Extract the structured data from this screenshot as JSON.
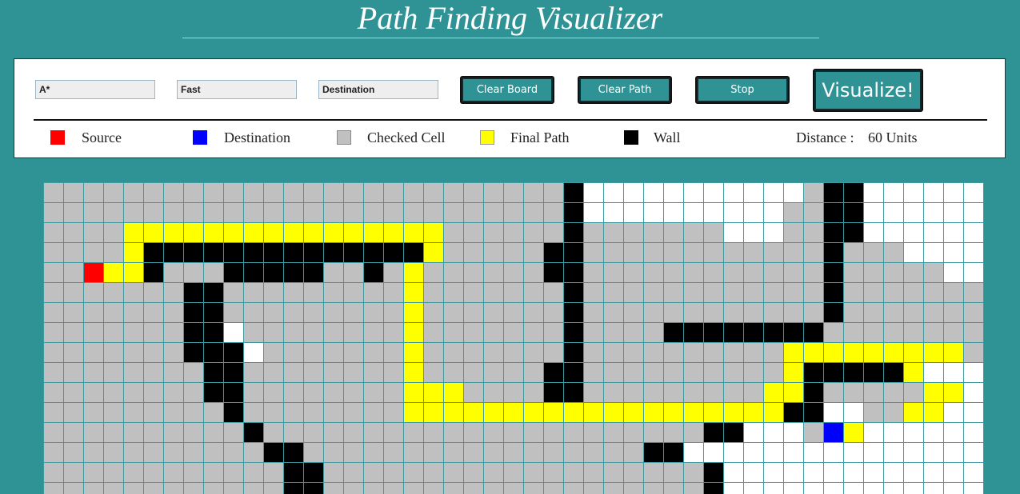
{
  "title": "Path Finding Visualizer",
  "controls": {
    "algorithm": "A*",
    "speed": "Fast",
    "mode": "Destination",
    "clear_board": "Clear Board",
    "clear_path": "Clear Path",
    "stop": "Stop",
    "visualize": "Visualize!"
  },
  "legend": [
    {
      "label": "Source",
      "color": "#ff0000"
    },
    {
      "label": "Destination",
      "color": "#0000ff"
    },
    {
      "label": "Checked Cell",
      "color": "#c0c0c0"
    },
    {
      "label": "Final Path",
      "color": "#ffff00"
    },
    {
      "label": "Wall",
      "color": "#000000"
    }
  ],
  "distance": {
    "label": "Distance :",
    "value": "60 Units"
  },
  "colors": {
    "background": "#2f9396",
    "checked": "#c0c0c0",
    "path": "#ffff00",
    "wall": "#000000",
    "empty": "#ffffff",
    "source": "#ff0000",
    "destination": "#0000ff"
  },
  "grid": {
    "legend": {
      ".": "checked",
      "o": "empty",
      "Y": "path",
      "W": "wall",
      "S": "source",
      "D": "destination"
    },
    "rows": [
      "..........................Wooooooooooo.WWooooooooooooooo",
      "..........................Woooooooooo..WWooooooooooooooo",
      "....YYYYYYYYYYYYYYYY......W.......ooo..WWooooooooooooooo",
      "....YWWWWWWWWWWWWWWY.....WW............W...ooooooooooooo",
      "..SYYW...WWWWW..W.Y......WW............W.....oooooooooooo",
      ".......WW.........Y.......W............W.......ooooooooo",
      ".......WW.........Y.......W............W.......oooooooooo",
      ".......WWo........Y.......W....WWWWWWWW..........ooooooo",
      ".......WWWo.......Y.......W..........YYYYYYYYY.ooooooooo",
      "........WW........Y......WW..........YWWWWWYoooooooooooo",
      "........WW........YYY....WW.........YYW.....YYooooooooooo",
      ".........W........YYYYYYYYYYYYYYYYYYYWWoo..YYooooooooooo",
      "..........W......................WWooo.DYoooooooooooo",
      "...........WW.................WWoooooooooooooooooooooooo",
      "............WW...................Woooooooooooooooooooooo",
      "............WW...................Wooooooooooooooooooooooo"
    ]
  }
}
